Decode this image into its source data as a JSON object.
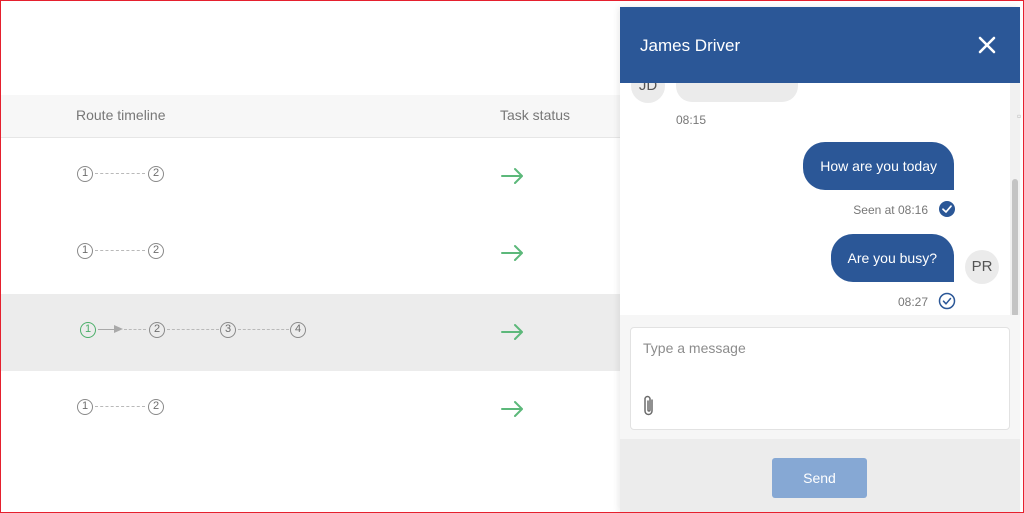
{
  "table": {
    "headers": {
      "route_timeline": "Route timeline",
      "task_status": "Task status"
    },
    "rows": [
      {
        "stops": [
          "1",
          "2"
        ],
        "completed_stops": 0,
        "status_icon": "arrow-right-icon",
        "selected": false
      },
      {
        "stops": [
          "1",
          "2"
        ],
        "completed_stops": 0,
        "status_icon": "arrow-right-icon",
        "selected": false
      },
      {
        "stops": [
          "1",
          "2",
          "3",
          "4"
        ],
        "completed_stops": 1,
        "status_icon": "arrow-right-icon",
        "selected": true
      },
      {
        "stops": [
          "1",
          "2"
        ],
        "completed_stops": 0,
        "status_icon": "arrow-right-icon",
        "selected": false
      }
    ]
  },
  "chat": {
    "title": "James Driver",
    "close_icon": "close-icon",
    "messages": [
      {
        "direction": "incoming",
        "avatar": "JD",
        "time": "08:15"
      },
      {
        "direction": "outgoing",
        "text": "How are you today",
        "meta": "Seen at 08:16",
        "read": true
      },
      {
        "direction": "outgoing",
        "text": "Are you busy?",
        "meta": "08:27",
        "read": false,
        "avatar": "PR"
      }
    ],
    "compose": {
      "placeholder": "Type a message",
      "value": "",
      "attach_icon": "paperclip-icon"
    },
    "send_label": "Send"
  },
  "colors": {
    "header": "#2b5797",
    "bubble_out": "#2b5797",
    "send_button": "#86a8d4",
    "status_arrow": "#5cb87a",
    "completed_stop": "#4caf6a",
    "frame": "#e5202e"
  }
}
